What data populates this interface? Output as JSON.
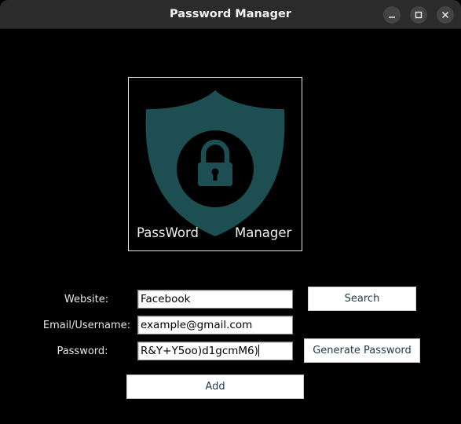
{
  "window": {
    "title": "Password Manager"
  },
  "logo": {
    "text_left": "PassWord",
    "text_right": "Manager",
    "shield_color": "#1d4e52"
  },
  "form": {
    "website_label": "Website:",
    "website_value": "Facebook",
    "email_label": "Email/Username:",
    "email_value": "example@gmail.com",
    "password_label": "Password:",
    "password_value": "R&Y+Y5oo)d1gcmM6)"
  },
  "buttons": {
    "search": "Search",
    "generate": "Generate Password",
    "add": "Add"
  }
}
